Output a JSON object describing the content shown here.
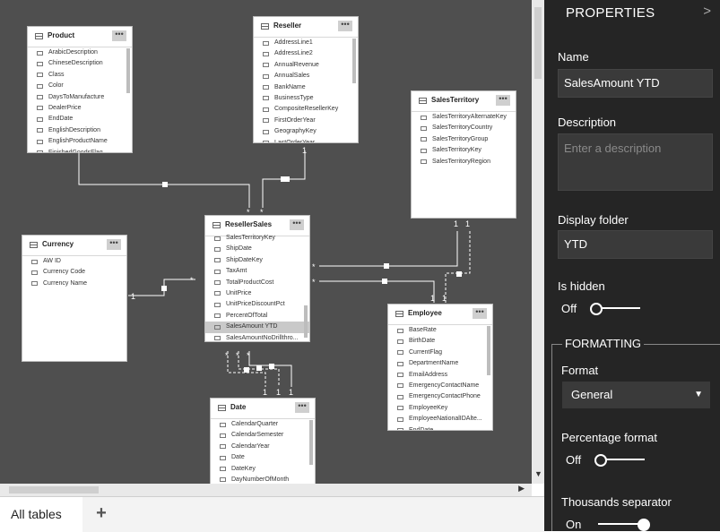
{
  "tables": {
    "product": {
      "name": "Product",
      "more": "•••",
      "fields": [
        "ArabicDescription",
        "ChineseDescription",
        "Class",
        "Color",
        "DaysToManufacture",
        "DealerPrice",
        "EndDate",
        "EnglishDescription",
        "EnglishProductName",
        "FinishedGoodsFlag"
      ]
    },
    "reseller": {
      "name": "Reseller",
      "more": "•••",
      "fields": [
        "AddressLine1",
        "AddressLine2",
        "AnnualRevenue",
        "AnnualSales",
        "BankName",
        "BusinessType",
        "CompositeResellerKey",
        "FirstOrderYear",
        "GeographyKey",
        "LastOrderYear"
      ]
    },
    "sales_territory": {
      "name": "SalesTerritory",
      "more": "•••",
      "fields": [
        "SalesTerritoryAlternateKey",
        "SalesTerritoryCountry",
        "SalesTerritoryGroup",
        "SalesTerritoryKey",
        "SalesTerritoryRegion"
      ]
    },
    "currency": {
      "name": "Currency",
      "more": "•••",
      "fields": [
        "AW ID",
        "Currency Code",
        "Currency Name"
      ]
    },
    "reseller_sales": {
      "name": "ResellerSales",
      "more": "•••",
      "fields": [
        "SalesTerritoryKey",
        "ShipDate",
        "ShipDateKey",
        "TaxAmt",
        "TotalProductCost",
        "UnitPrice",
        "UnitPriceDiscountPct",
        "PercentOfTotal",
        "SalesAmount YTD",
        "SalesAmountNoDrillthro..."
      ],
      "selected": "SalesAmount YTD"
    },
    "employee": {
      "name": "Employee",
      "more": "•••",
      "fields": [
        "BaseRate",
        "BirthDate",
        "CurrentFlag",
        "DepartmentName",
        "EmailAddress",
        "EmergencyContactName",
        "EmergencyContactPhone",
        "EmployeeKey",
        "EmployeeNationalIDAlte...",
        "EndDate"
      ]
    },
    "date": {
      "name": "Date",
      "more": "•••",
      "fields": [
        "CalendarQuarter",
        "CalendarSemester",
        "CalendarYear",
        "Date",
        "DateKey",
        "DayNumberOfMonth"
      ]
    }
  },
  "relationships": {
    "cardinality_one": "1",
    "cardinality_many": "*"
  },
  "tabs": {
    "all_tables": "All tables",
    "add": "+"
  },
  "properties": {
    "title": "PROPERTIES",
    "collapse_glyph": ">",
    "name_label": "Name",
    "name_value": "SalesAmount YTD",
    "description_label": "Description",
    "description_placeholder": "Enter a description",
    "display_folder_label": "Display folder",
    "display_folder_value": "YTD",
    "is_hidden_label": "Is hidden",
    "is_hidden_state": "Off",
    "formatting_title": "FORMATTING",
    "format_label": "Format",
    "format_value": "General",
    "percentage_format_label": "Percentage format",
    "percentage_format_state": "Off",
    "thousands_separator_label": "Thousands separator",
    "thousands_separator_state": "On"
  },
  "colors": {
    "canvas": "#4f4f4f",
    "panel": "#252525",
    "selected_row": "#c9c9c9"
  }
}
